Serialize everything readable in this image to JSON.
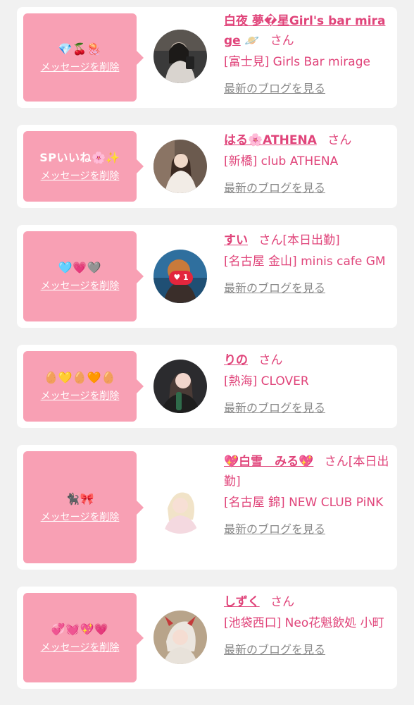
{
  "colors": {
    "bubble": "#f8a0b4",
    "accent": "#e0447a",
    "muted": "#8a8a8a",
    "background": "#f1f1f1",
    "card": "#ffffff"
  },
  "cards": [
    {
      "message": "💎🍒🪼",
      "delete_label": "メッセージを削除",
      "name": "白夜 夢�星Girl's bar mirage",
      "suffix_icon": "🪐",
      "honorific": "さん",
      "status": "",
      "shop": "[富士見] Girls Bar mirage",
      "blog_label": "最新のブログを見る",
      "avatar_icon": "girl-photo-mirror"
    },
    {
      "message": "SPいいね🌸✨",
      "delete_label": "メッセージを削除",
      "name": "はる🌸ATHENA",
      "suffix_icon": "",
      "honorific": "さん",
      "status": "",
      "shop": "[新橋] club ATHENA",
      "blog_label": "最新のブログを見る",
      "avatar_icon": "girl-photo-dress"
    },
    {
      "message": "🩵💗🩶",
      "delete_label": "メッセージを削除",
      "name": "すい",
      "suffix_icon": "",
      "honorific": "さん",
      "status": "[本日出勤]",
      "shop": "[名古屋 金山] minis cafe GM",
      "blog_label": "最新のブログを見る",
      "avatar_icon": "girl-photo-heart",
      "avatar_badge": "♥ 1"
    },
    {
      "message": "🥚💛🥚🧡🥚",
      "delete_label": "メッセージを削除",
      "name": "りの",
      "suffix_icon": "",
      "honorific": "さん",
      "status": "",
      "shop": "[熱海] CLOVER",
      "blog_label": "最新のブログを見る",
      "avatar_icon": "girl-photo-bottle"
    },
    {
      "message": "🐈‍⬛🎀",
      "delete_label": "メッセージを削除",
      "name": "💖白雪　みる💖",
      "suffix_icon": "",
      "honorific": "さん",
      "status": "[本日出勤]",
      "shop": "[名古屋 錦] NEW CLUB PiNK",
      "blog_label": "最新のブログを見る",
      "avatar_icon": "girl-photo-blonde"
    },
    {
      "message": "💞💓💖💗",
      "delete_label": "メッセージを削除",
      "name": "しずく",
      "suffix_icon": "",
      "honorific": "さん",
      "status": "",
      "shop": "[池袋西口] Neo花魁飲処 小町",
      "blog_label": "最新のブログを見る",
      "avatar_icon": "girl-photo-horns"
    }
  ]
}
